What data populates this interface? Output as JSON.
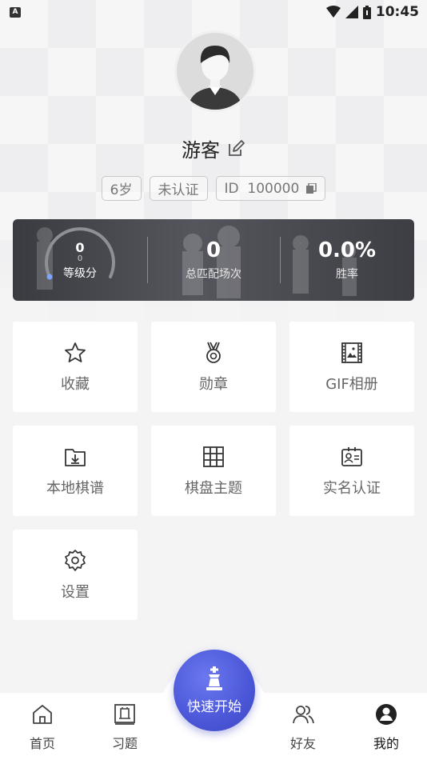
{
  "status": {
    "time": "10:45",
    "badge": "A"
  },
  "profile": {
    "name": "游客",
    "tags": {
      "age": "6岁",
      "auth": "未认证",
      "id": "ID  100000"
    }
  },
  "stats": {
    "level_value": "0",
    "level_sub": "0",
    "level_label": "等级分",
    "matches_value": "0",
    "matches_label": "总匹配场次",
    "winrate_value": "0.0%",
    "winrate_label": "胜率"
  },
  "menu": [
    {
      "label": "收藏",
      "icon": "star-icon"
    },
    {
      "label": "勋章",
      "icon": "medal-icon"
    },
    {
      "label": "GIF相册",
      "icon": "gif-album-icon"
    },
    {
      "label": "本地棋谱",
      "icon": "folder-download-icon"
    },
    {
      "label": "棋盘主题",
      "icon": "board-grid-icon"
    },
    {
      "label": "实名认证",
      "icon": "id-card-icon"
    },
    {
      "label": "设置",
      "icon": "gear-icon"
    }
  ],
  "tabbar": {
    "home": "首页",
    "practice": "习题",
    "quick_start": "快速开始",
    "friends": "好友",
    "mine": "我的"
  },
  "colors": {
    "accent": "#4b57d8",
    "card_dark": "#45464c"
  }
}
